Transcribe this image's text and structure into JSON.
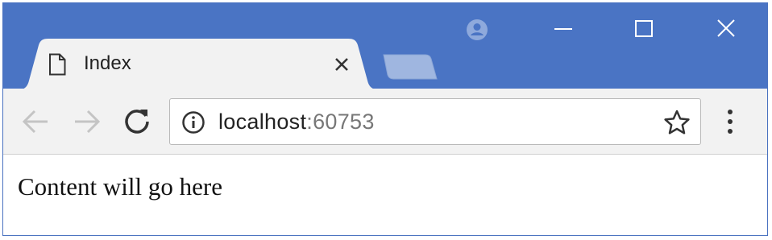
{
  "tab": {
    "title": "Index",
    "icon": "page-icon"
  },
  "address_bar": {
    "host": "localhost",
    "port": ":60753"
  },
  "page": {
    "content_text": "Content will go here"
  },
  "icons": {
    "back": "back-arrow-icon",
    "forward": "forward-arrow-icon",
    "reload": "reload-icon",
    "info": "info-icon",
    "star": "star-icon",
    "menu": "menu-icon",
    "profile": "profile-icon",
    "minimize": "minimize-icon",
    "maximize": "maximize-icon",
    "close": "close-icon"
  },
  "colors": {
    "titlebar": "#4a74c4",
    "toolbar": "#f2f2f2",
    "tab_active": "#f2f2f2",
    "tab_inactive": "#9fb6e0"
  }
}
